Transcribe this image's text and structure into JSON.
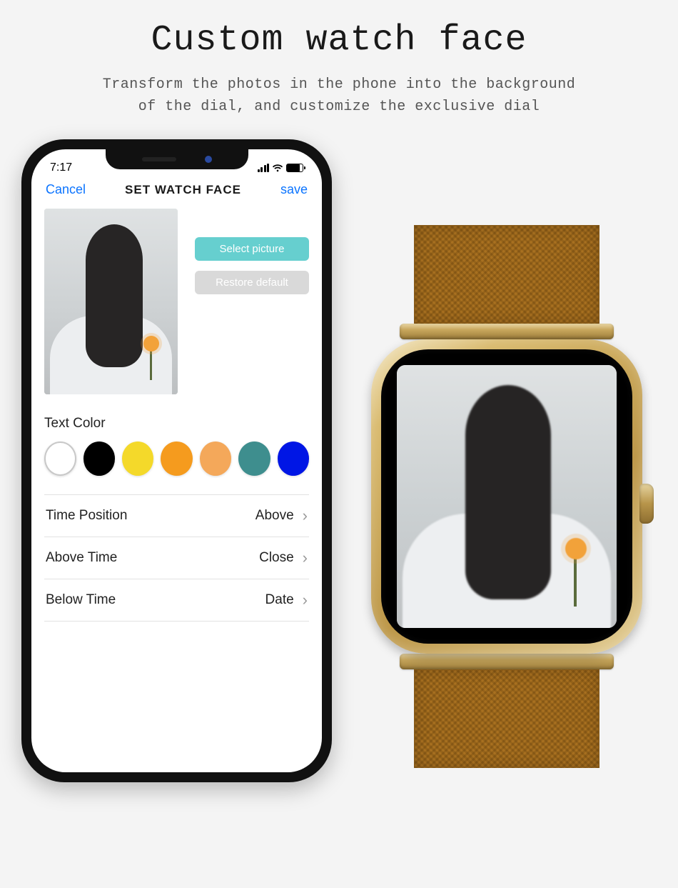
{
  "hero": {
    "title": "Custom watch face",
    "subtitle_l1": "Transform the photos in the phone into the background",
    "subtitle_l2": "of the dial, and customize the exclusive dial"
  },
  "phone": {
    "status": {
      "time": "7:17"
    },
    "nav": {
      "cancel": "Cancel",
      "title": "SET WATCH FACE",
      "save": "save"
    },
    "buttons": {
      "select_picture": "Select picture",
      "restore_default": "Restore default"
    },
    "text_color_label": "Text Color",
    "colors": [
      "#ffffff",
      "#000000",
      "#f4d92a",
      "#f59b1e",
      "#f4a85a",
      "#3e8e8e",
      "#0016e5"
    ],
    "rows": [
      {
        "label": "Time Position",
        "value": "Above"
      },
      {
        "label": "Above Time",
        "value": "Close"
      },
      {
        "label": "Below Time",
        "value": "Date"
      }
    ]
  }
}
